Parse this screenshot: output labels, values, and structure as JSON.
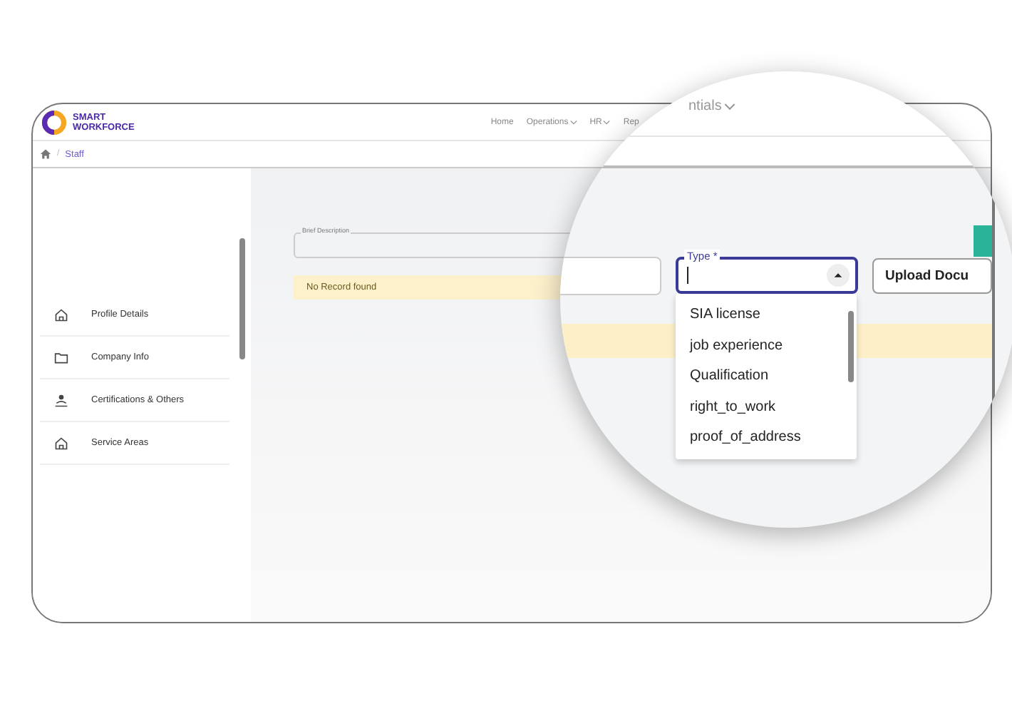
{
  "app": {
    "logo_lines": [
      "SMART",
      "WORKFORCE"
    ]
  },
  "nav": [
    {
      "label": "Home",
      "dropdown": false
    },
    {
      "label": "Operations",
      "dropdown": true
    },
    {
      "label": "HR",
      "dropdown": true
    },
    {
      "label": "Rep",
      "dropdown": false
    }
  ],
  "breadcrumb": {
    "separator": "/",
    "items": [
      "Staff"
    ]
  },
  "sidebar": {
    "items": [
      {
        "label": "Profile Details",
        "kind": "home"
      },
      {
        "label": "Company Info",
        "kind": "folder"
      },
      {
        "label": "Certifications & Others",
        "kind": "person"
      },
      {
        "label": "Service Areas",
        "kind": "home"
      }
    ]
  },
  "form": {
    "brief_description": {
      "label": "Brief Description"
    },
    "notice": "No Record found"
  },
  "magnifier": {
    "nav_fragment": {
      "label": "ntials",
      "dropdown": true
    },
    "type_field": {
      "label": "Type *",
      "expanded": true,
      "options": [
        "SIA license",
        "job experience",
        "Qualification",
        "right_to_work",
        "proof_of_address"
      ]
    },
    "upload_button": "Upload Docu"
  }
}
